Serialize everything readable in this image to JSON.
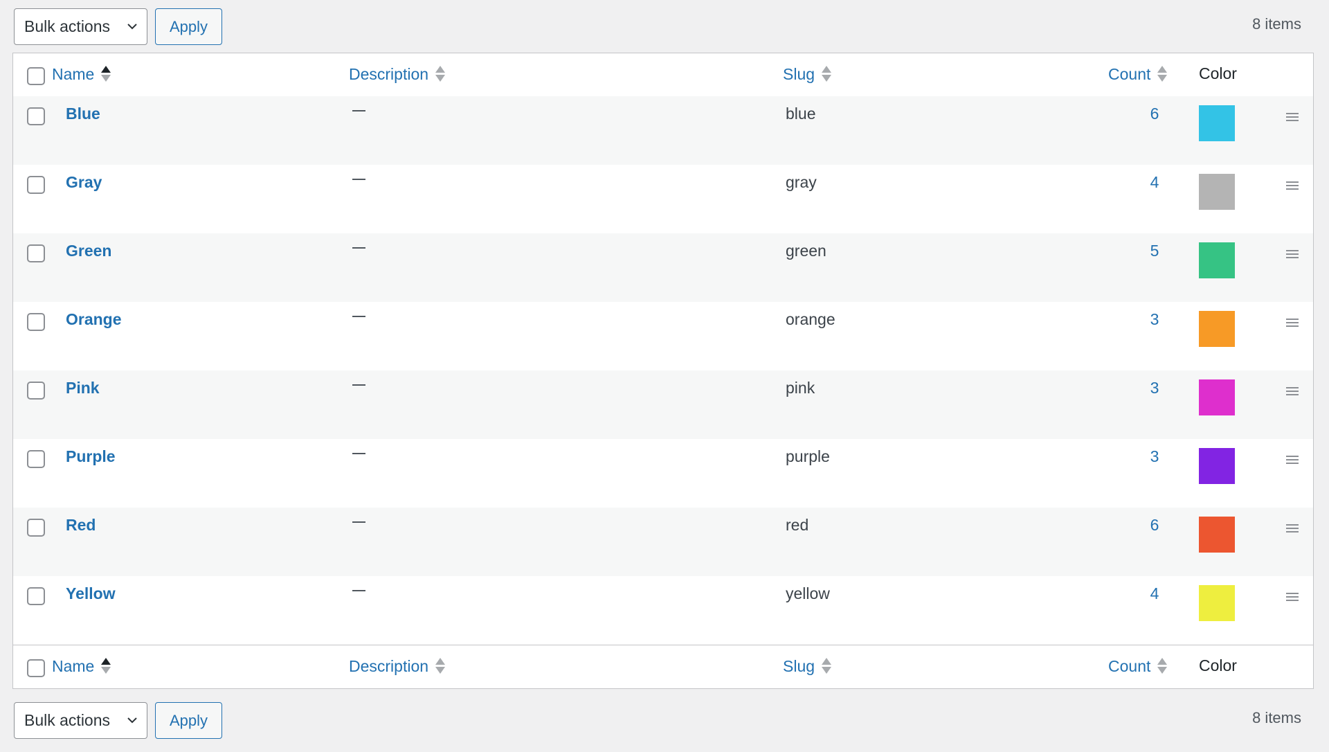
{
  "toolbar": {
    "bulk_actions_label": "Bulk actions",
    "apply_label": "Apply",
    "items_count": "8 items"
  },
  "columns": {
    "name": "Name",
    "description": "Description",
    "slug": "Slug",
    "count": "Count",
    "color": "Color"
  },
  "sort": {
    "column": "name",
    "direction": "asc"
  },
  "rows": [
    {
      "name": "Blue",
      "description": "—",
      "slug": "blue",
      "count": "6",
      "color": "#33c3e6"
    },
    {
      "name": "Gray",
      "description": "—",
      "slug": "gray",
      "count": "4",
      "color": "#b4b4b4"
    },
    {
      "name": "Green",
      "description": "—",
      "slug": "green",
      "count": "5",
      "color": "#36c384"
    },
    {
      "name": "Orange",
      "description": "—",
      "slug": "orange",
      "count": "3",
      "color": "#f79a26"
    },
    {
      "name": "Pink",
      "description": "—",
      "slug": "pink",
      "count": "3",
      "color": "#de2fcd"
    },
    {
      "name": "Purple",
      "description": "—",
      "slug": "purple",
      "count": "3",
      "color": "#8224e3"
    },
    {
      "name": "Red",
      "description": "—",
      "slug": "red",
      "count": "6",
      "color": "#ec5630"
    },
    {
      "name": "Yellow",
      "description": "—",
      "slug": "yellow",
      "count": "4",
      "color": "#eeee3f"
    }
  ],
  "icons": {
    "chevron": "chevron-down-icon",
    "sort": "sort-arrows-icon",
    "drag": "drag-handle-icon"
  }
}
